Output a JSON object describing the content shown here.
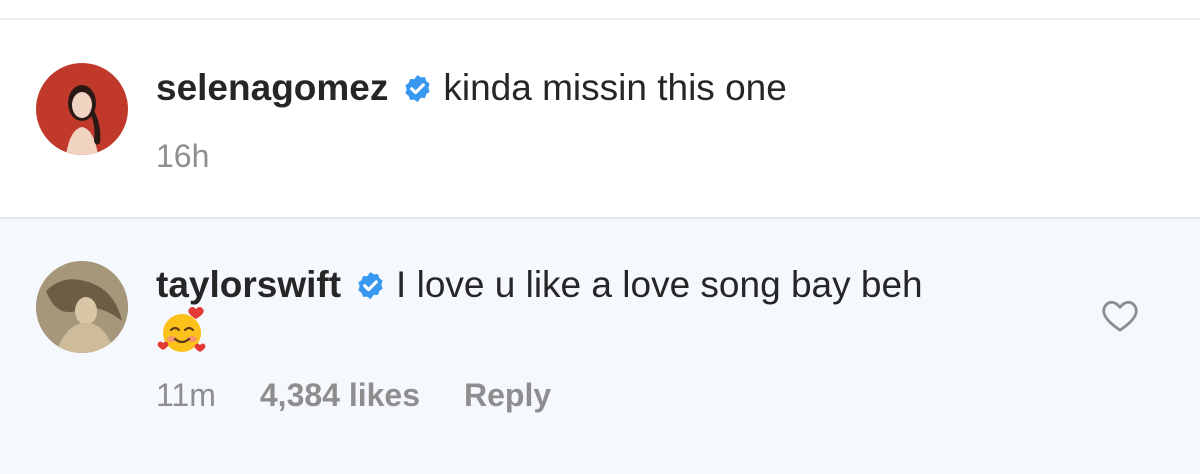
{
  "comments": [
    {
      "username": "selenagomez",
      "verified": true,
      "text": "kinda missin this one",
      "time": "16h",
      "avatar_icon": "avatar-selena"
    },
    {
      "username": "taylorswift",
      "verified": true,
      "text": "I love u like a love song bay beh",
      "emoji": "smiling-face-with-hearts",
      "time": "11m",
      "likes": "4,384 likes",
      "reply_label": "Reply",
      "avatar_icon": "avatar-taylor"
    }
  ],
  "colors": {
    "verified_blue": "#3897f0",
    "meta_gray": "#8e8e8e",
    "highlight_bg": "#f5f8fd"
  }
}
